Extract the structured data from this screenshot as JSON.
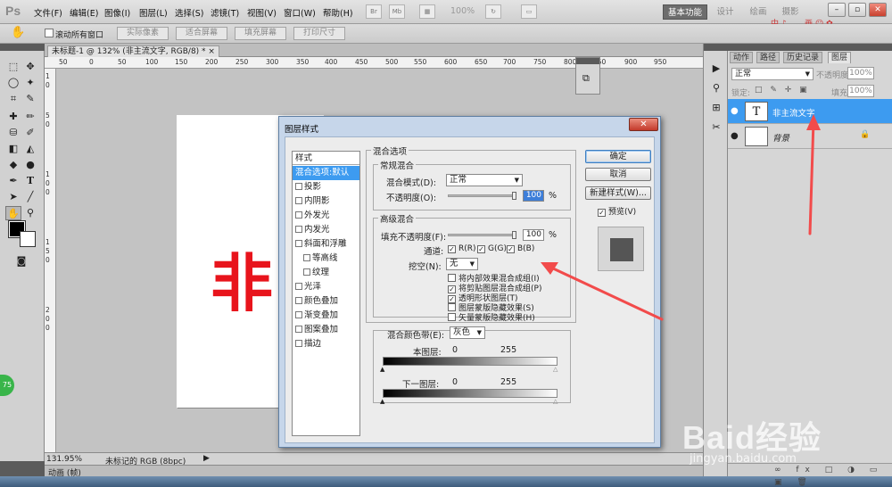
{
  "app": {
    "logo": "Ps"
  },
  "menu": [
    "文件(F)",
    "编辑(E)",
    "图像(I)",
    "图层(L)",
    "选择(S)",
    "滤镜(T)",
    "视图(V)",
    "窗口(W)",
    "帮助(H)"
  ],
  "toolbar_icons": [
    "Br",
    "Mb"
  ],
  "zoom_level": "100%",
  "workspaces": {
    "basic": "基本功能",
    "design": "设计",
    "paint": "绘画",
    "photo": "摄影"
  },
  "ime": "中 ♪ 。 , 画 ☺ ✿",
  "options": {
    "scroll_all": "滚动所有窗口",
    "actual_pixels": "实际像素",
    "fit_screen": "适合屏幕",
    "fill_screen": "填充屏幕",
    "print_size": "打印尺寸"
  },
  "document": {
    "tab": "未标题-1 @ 132% (非主流文字, RGB/8) * ×",
    "canvas_text": "非",
    "zoom": "131.95%",
    "status": "未标记的 RGB (8bpc)",
    "ruler_h": [
      "50",
      "0",
      "50",
      "100",
      "150",
      "200",
      "250",
      "300",
      "350",
      "400",
      "450",
      "500",
      "550",
      "600",
      "650",
      "700",
      "750",
      "800",
      "850",
      "900",
      "950"
    ],
    "ruler_v": [
      "1",
      "0",
      "5",
      "0",
      "1",
      "0",
      "0",
      "1",
      "5",
      "0",
      "2",
      "0",
      "0"
    ]
  },
  "anim_panel": "动画 (帧)",
  "badge": "75",
  "layers_panel": {
    "tabs": [
      "动作",
      "路径",
      "历史记录",
      "图层"
    ],
    "blend_mode": "正常",
    "opacity_label": "不透明度:",
    "opacity": "100%",
    "lock_label": "锁定:",
    "lock_icons": "□ ✎ ✛ ▣",
    "fill_label": "填充:",
    "fill": "100%",
    "layers": [
      {
        "name": "非主流文字",
        "thumb": "T",
        "eye": "●"
      },
      {
        "name": "背景",
        "thumb": "",
        "eye": "●",
        "lock": "🔒"
      }
    ],
    "footer": "∞ fx □ ◑ ▭ ▣ 🗑"
  },
  "dialog": {
    "title": "图层样式",
    "close": "✕",
    "styles_header": "样式",
    "styles": [
      {
        "label": "混合选项:默认",
        "selected": true,
        "check": false,
        "sub": false
      },
      {
        "label": "投影",
        "check": true,
        "sub": false
      },
      {
        "label": "内阴影",
        "check": true,
        "sub": false
      },
      {
        "label": "外发光",
        "check": true,
        "sub": false
      },
      {
        "label": "内发光",
        "check": true,
        "sub": false
      },
      {
        "label": "斜面和浮雕",
        "check": true,
        "sub": false
      },
      {
        "label": "等高线",
        "check": true,
        "sub": true
      },
      {
        "label": "纹理",
        "check": true,
        "sub": true
      },
      {
        "label": "光泽",
        "check": true,
        "sub": false
      },
      {
        "label": "颜色叠加",
        "check": true,
        "sub": false
      },
      {
        "label": "渐变叠加",
        "check": true,
        "sub": false
      },
      {
        "label": "图案叠加",
        "check": true,
        "sub": false
      },
      {
        "label": "描边",
        "check": true,
        "sub": false
      }
    ],
    "blend_options_title": "混合选项",
    "general_title": "常规混合",
    "blend_mode_label": "混合模式(D):",
    "blend_mode_value": "正常",
    "opacity_label": "不透明度(O):",
    "opacity_value": "100",
    "pct": "%",
    "advanced_title": "高级混合",
    "fill_opacity_label": "填充不透明度(F):",
    "fill_opacity_value": "100",
    "channels_label": "通道:",
    "channel_r": "R(R)",
    "channel_g": "G(G)",
    "channel_b": "B(B)",
    "knockout_label": "挖空(N):",
    "knockout_value": "无",
    "options": [
      {
        "label": "将内部效果混合成组(I)",
        "checked": false
      },
      {
        "label": "将剪贴图层混合成组(P)",
        "checked": true
      },
      {
        "label": "透明形状图层(T)",
        "checked": true
      },
      {
        "label": "图层蒙版隐藏效果(S)",
        "checked": false
      },
      {
        "label": "矢量蒙版隐藏效果(H)",
        "checked": false
      }
    ],
    "blend_if_label": "混合颜色带(E):",
    "blend_if_value": "灰色",
    "this_layer_label": "本图层:",
    "under_layer_label": "下一图层:",
    "range_min": "0",
    "range_max": "255",
    "buttons": {
      "ok": "确定",
      "cancel": "取消",
      "new_style": "新建样式(W)...",
      "preview": "预览(V)"
    },
    "check_mark": "✓"
  },
  "watermark": {
    "brand": "Baid经验",
    "url": "jingyan.baidu.com"
  },
  "colors": {
    "accent": "#3d9bf0",
    "annotation_arrow": "#f24b4b",
    "canvas_text": "#e8141c"
  }
}
